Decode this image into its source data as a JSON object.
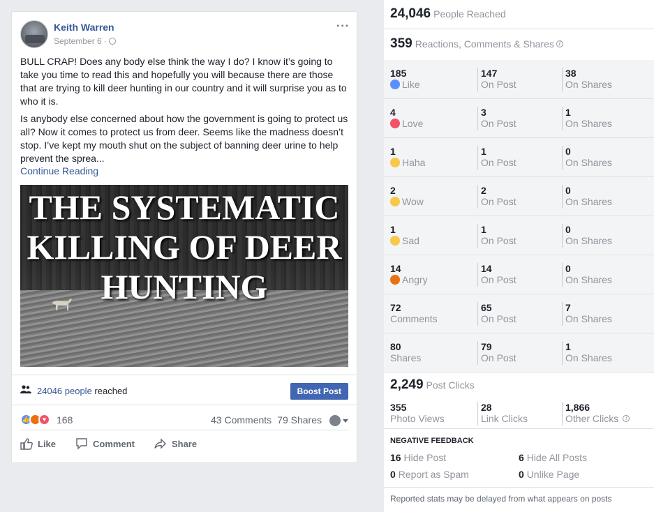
{
  "post": {
    "author": "Keith Warren",
    "date": "September 6 ·",
    "paragraph1": "BULL CRAP! Does any body else think the way I do? I know it’s going to take you time to read this and hopefully you will because there are those that are trying to kill deer hunting in our country and it will surprise you as to who it is.",
    "paragraph2": "Is anybody else concerned about how the government is going to protect us all? Now it comes to protect us from deer. Seems like the madness doesn’t stop. I’ve kept my mouth shut on the subject of banning deer urine to help prevent the sprea...",
    "continue_label": "Continue Reading",
    "image_headline_1": "THE SYSTEMATIC",
    "image_headline_2": "KILLING OF DEER",
    "image_headline_3": "HUNTING",
    "reach_count": "24046 people",
    "reach_suffix": " reached",
    "boost_label": "Boost Post",
    "reactions_count": "168",
    "comments_text": "43 Comments",
    "shares_text": "79 Shares",
    "actions": {
      "like": "Like",
      "comment": "Comment",
      "share": "Share"
    }
  },
  "insights": {
    "people_reached": {
      "value": "24,046",
      "label": "People Reached"
    },
    "engagement": {
      "value": "359",
      "label": "Reactions, Comments & Shares"
    },
    "rows": [
      {
        "total": "185",
        "name": "Like",
        "icon": "like",
        "on_post": "147",
        "on_shares": "38"
      },
      {
        "total": "4",
        "name": "Love",
        "icon": "love",
        "on_post": "3",
        "on_shares": "1"
      },
      {
        "total": "1",
        "name": "Haha",
        "icon": "haha",
        "on_post": "1",
        "on_shares": "0"
      },
      {
        "total": "2",
        "name": "Wow",
        "icon": "wow",
        "on_post": "2",
        "on_shares": "0"
      },
      {
        "total": "1",
        "name": "Sad",
        "icon": "sad",
        "on_post": "1",
        "on_shares": "0"
      },
      {
        "total": "14",
        "name": "Angry",
        "icon": "angry",
        "on_post": "14",
        "on_shares": "0"
      },
      {
        "total": "72",
        "name": "Comments",
        "icon": "",
        "on_post": "65",
        "on_shares": "7"
      },
      {
        "total": "80",
        "name": "Shares",
        "icon": "",
        "on_post": "79",
        "on_shares": "1"
      }
    ],
    "on_post_label": "On Post",
    "on_shares_label": "On Shares",
    "post_clicks": {
      "value": "2,249",
      "label": "Post Clicks"
    },
    "clicks": [
      {
        "value": "355",
        "label": "Photo Views"
      },
      {
        "value": "28",
        "label": "Link Clicks"
      },
      {
        "value": "1,866",
        "label": "Other Clicks"
      }
    ],
    "negative_title": "NEGATIVE FEEDBACK",
    "negative": [
      {
        "value": "16",
        "label": "Hide Post"
      },
      {
        "value": "6",
        "label": "Hide All Posts"
      },
      {
        "value": "0",
        "label": "Report as Spam"
      },
      {
        "value": "0",
        "label": "Unlike Page"
      }
    ],
    "footer": "Reported stats may be delayed from what appears on posts"
  },
  "colors": {
    "link": "#365899",
    "boost": "#4267b2",
    "muted": "#90949c"
  }
}
